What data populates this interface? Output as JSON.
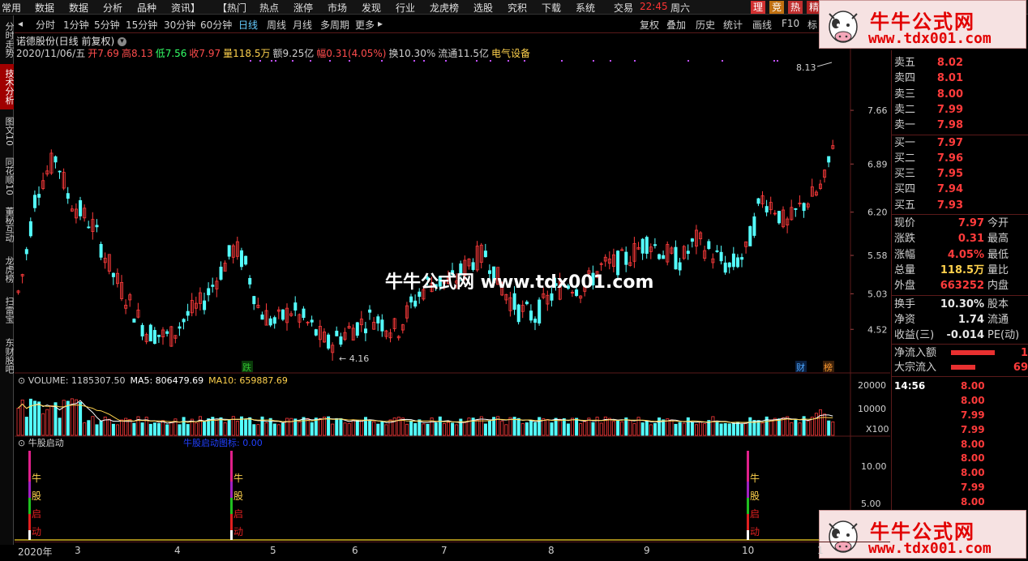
{
  "menu": [
    "常用",
    "数据",
    "数据",
    "分析",
    "品种",
    "资讯】",
    "【热门",
    "热点",
    "涨停",
    "市场",
    "发现",
    "行业",
    "龙虎榜",
    "选股",
    "究积",
    "下载",
    "系统",
    "交易"
  ],
  "clock": {
    "time": "22:45",
    "day": "周六"
  },
  "top_buttons": [
    "理",
    "竞",
    "热",
    "精"
  ],
  "left_tabs": [
    "分时走势",
    "技术分析",
    "图文10",
    "同花顺10",
    "董秘互动",
    "龙虎榜",
    "扫雷宝",
    "东财股吧"
  ],
  "periods": [
    "分时",
    "1分钟",
    "5分钟",
    "15分钟",
    "30分钟",
    "60分钟",
    "日线",
    "周线",
    "月线",
    "多周期",
    "更多"
  ],
  "period_active": "日线",
  "right_tools": [
    "复权",
    "叠加",
    "历史",
    "统计",
    "画线",
    "F10",
    "标"
  ],
  "stock": {
    "name": "诺德股份(日线 前复权)"
  },
  "info": {
    "date": "2020/11/06/五",
    "open": "开7.69",
    "high": "高8.13",
    "low": "低7.56",
    "close": "收7.97",
    "vol": "量118.5万",
    "amount": "额9.25亿",
    "change": "幅0.31(4.05%)",
    "turnover": "换10.30%",
    "float": "流通11.5亿",
    "sector": "电气设备"
  },
  "price_axis": [
    "7.66",
    "6.89",
    "6.20",
    "5.58",
    "5.03",
    "4.52"
  ],
  "annot": {
    "high": "8.13",
    "low": "4.16",
    "die": "跌",
    "cai": "财",
    "bang": "榜"
  },
  "volume": {
    "label": "VOLUME: 1185307.50",
    "ma5": "MA5: 806479.69",
    "ma10": "MA10: 659887.69",
    "axis": [
      "20000",
      "10000"
    ],
    "unit": "X100"
  },
  "indicator": {
    "name": "牛股启动",
    "line_label": "牛股启动图标: 0.00",
    "axis": [
      "10.00",
      "5.00"
    ],
    "chars": [
      "牛",
      "股",
      "启",
      "动"
    ]
  },
  "dates": [
    "2020年",
    "3",
    "4",
    "5",
    "6",
    "7",
    "8",
    "9",
    "10",
    "1"
  ],
  "quote": [
    {
      "label": "卖五",
      "value": "8.02"
    },
    {
      "label": "卖四",
      "value": "8.01"
    },
    {
      "label": "卖三",
      "value": "8.00"
    },
    {
      "label": "卖二",
      "value": "7.99"
    },
    {
      "label": "卖一",
      "value": "7.98"
    },
    {
      "label": "买一",
      "value": "7.97"
    },
    {
      "label": "买二",
      "value": "7.96"
    },
    {
      "label": "买三",
      "value": "7.95"
    },
    {
      "label": "买四",
      "value": "7.94"
    },
    {
      "label": "买五",
      "value": "7.93"
    }
  ],
  "stats": [
    {
      "label": "现价",
      "value": "7.97",
      "ext": "今开"
    },
    {
      "label": "涨跌",
      "value": "0.31",
      "ext": "最高"
    },
    {
      "label": "涨幅",
      "value": "4.05%",
      "ext": "最低"
    },
    {
      "label": "总量",
      "value": "118.5万",
      "ext": "量比"
    },
    {
      "label": "外盘",
      "value": "663252",
      "ext": "内盘"
    },
    {
      "label": "换手",
      "value": "10.30%",
      "ext": "股本"
    },
    {
      "label": "净资",
      "value": "1.74",
      "ext": "流通"
    },
    {
      "label": "收益(三)",
      "value": "-0.014",
      "ext": "PE(动)"
    }
  ],
  "flows": [
    {
      "label": "净流入额",
      "value": "1"
    },
    {
      "label": "大宗流入",
      "value": "69"
    }
  ],
  "ticks": [
    {
      "time": "14:56",
      "price": "8.00"
    },
    {
      "time": "",
      "price": "8.00"
    },
    {
      "time": "",
      "price": "7.99"
    },
    {
      "time": "",
      "price": "7.99"
    },
    {
      "time": "",
      "price": "8.00"
    },
    {
      "time": "",
      "price": "8.00"
    },
    {
      "time": "",
      "price": "8.00"
    },
    {
      "time": "",
      "price": "7.99"
    },
    {
      "time": "",
      "price": "8.00"
    }
  ],
  "watermark": {
    "title": "牛牛公式网",
    "url": "www.tdx001.com",
    "center": "牛牛公式网 www.tdx001.com"
  },
  "colors": {
    "up": "#ff3b3b",
    "down": "#54ffff",
    "ma5": "#ffffff",
    "ma10": "#ffd24d",
    "grid": "#5a1a1a"
  }
}
